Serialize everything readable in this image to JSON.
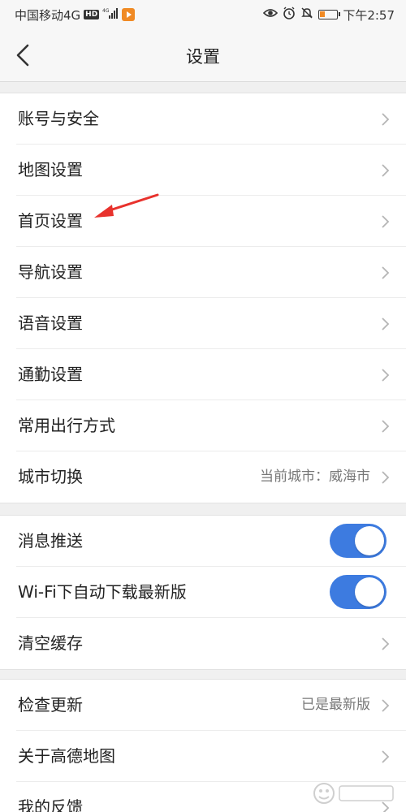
{
  "status_bar": {
    "carrier": "中国移动4G",
    "hd": "HD",
    "network": "4G",
    "time": "下午2:57"
  },
  "nav": {
    "title": "设置"
  },
  "group1": {
    "items": [
      {
        "label": "账号与安全"
      },
      {
        "label": "地图设置"
      },
      {
        "label": "首页设置"
      },
      {
        "label": "导航设置"
      },
      {
        "label": "语音设置"
      },
      {
        "label": "通勤设置"
      },
      {
        "label": "常用出行方式"
      },
      {
        "label": "城市切换",
        "value": "当前城市：威海市"
      }
    ]
  },
  "group2": {
    "items": [
      {
        "label": "消息推送",
        "toggle_on": true
      },
      {
        "label": "Wi-Fi下自动下载最新版",
        "toggle_on": true
      },
      {
        "label": "清空缓存"
      }
    ]
  },
  "group3": {
    "items": [
      {
        "label": "检查更新",
        "value": "已是最新版"
      },
      {
        "label": "关于高德地图"
      },
      {
        "label": "我的反馈"
      }
    ]
  },
  "colors": {
    "toggle_on": "#3d7be0",
    "annotation_arrow": "#e8322d"
  },
  "icons": [
    "back-icon",
    "chevron-right-icon",
    "eye-icon",
    "alarm-icon",
    "mute-icon",
    "battery-icon",
    "signal-icon",
    "app-notification-icon"
  ]
}
